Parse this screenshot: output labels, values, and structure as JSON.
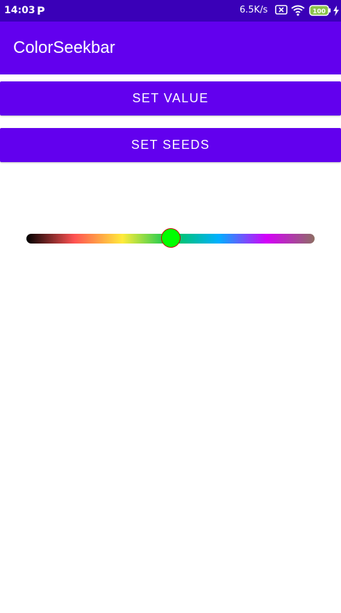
{
  "status_bar": {
    "time": "14:03",
    "app_badge": "P",
    "speed": "6.5K/s",
    "battery": "100",
    "icons": [
      "sim-disabled-icon",
      "wifi-icon",
      "battery-icon",
      "charging-icon"
    ],
    "background": "#3a00b8"
  },
  "app_bar": {
    "title": "ColorSeekbar",
    "background": "#6200ee"
  },
  "buttons": {
    "set_value": "SET VALUE",
    "set_seeds": "SET SEEDS"
  },
  "seekbar": {
    "seed_colors": [
      "#000000",
      "#ff5252",
      "#ffeb3b",
      "#00c853",
      "#00b0ff",
      "#d500f9",
      "#8d6e63"
    ],
    "progress": 0.5,
    "thumb_color": "#00ff00",
    "thumb_border": "#cc0000"
  }
}
